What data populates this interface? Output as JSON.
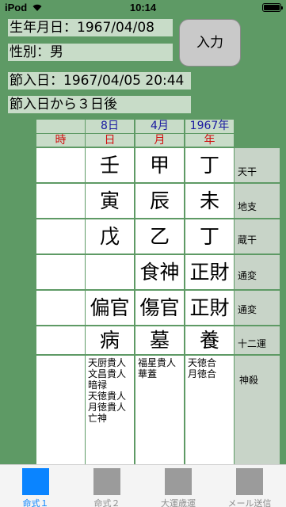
{
  "status": {
    "carrier": "iPod",
    "time": "10:14"
  },
  "form": {
    "birth_label": "生年月日：",
    "birth_value": "1967/04/08",
    "gender_label": "性別：",
    "gender_value": "男",
    "setsuiri_label": "節入日：",
    "setsuiri_value": "1967/04/05 20:44",
    "after_text": "節入日から３日後",
    "input_button": "入力"
  },
  "header": {
    "day": "8日",
    "month": "4月",
    "year": "1967年"
  },
  "pillars": {
    "hour": "時",
    "day": "日",
    "month": "月",
    "year": "年"
  },
  "rows": [
    {
      "label": "天干",
      "hour": "",
      "day": "壬",
      "month": "甲",
      "year": "丁"
    },
    {
      "label": "地支",
      "hour": "",
      "day": "寅",
      "month": "辰",
      "year": "未"
    },
    {
      "label": "蔵干",
      "hour": "",
      "day": "戊",
      "month": "乙",
      "year": "丁"
    },
    {
      "label": "通変",
      "hour": "",
      "day": "",
      "month": "食神",
      "year": "正財"
    },
    {
      "label": "通変",
      "hour": "",
      "day": "偏官",
      "month": "傷官",
      "year": "正財"
    },
    {
      "label": "十二運",
      "hour": "",
      "day": "病",
      "month": "墓",
      "year": "養"
    }
  ],
  "shinsatsu": {
    "label": "神殺",
    "day": [
      "天厨貴人",
      "文昌貴人",
      "暗禄",
      "天徳貴人",
      "月徳貴人",
      "亡神"
    ],
    "month": [
      "福星貴人",
      "華蓋"
    ],
    "year": [
      "天徳合",
      "月徳合"
    ]
  },
  "tabs": [
    {
      "label": "命式１"
    },
    {
      "label": "命式２"
    },
    {
      "label": "大運歳運"
    },
    {
      "label": "メール送信"
    }
  ]
}
